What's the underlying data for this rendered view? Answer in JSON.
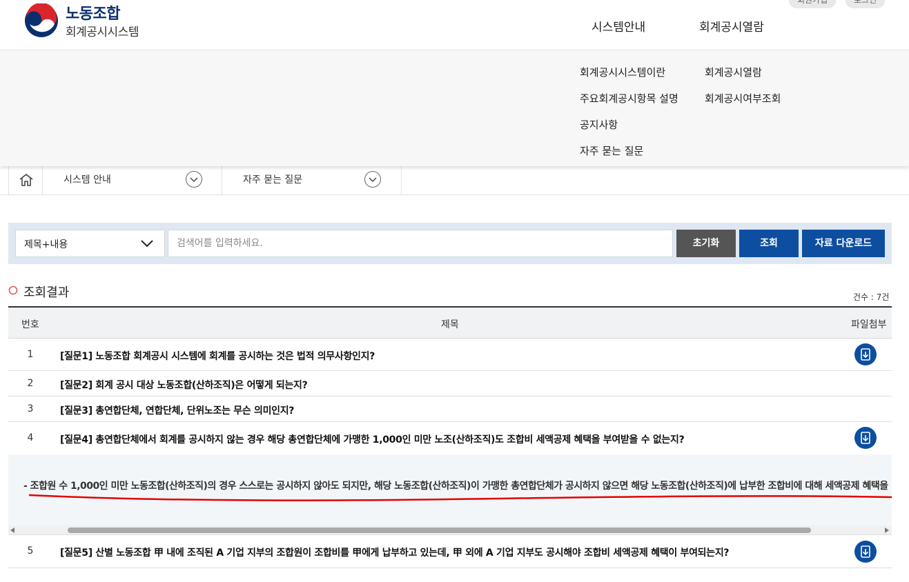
{
  "header": {
    "logo_title": "노동조합",
    "logo_subtitle": "회계공시시스템",
    "util_links": [
      "회원가입",
      "로그인"
    ],
    "nav": [
      "시스템안내",
      "회계공시열람"
    ]
  },
  "mega_menu": {
    "col1": [
      "회계공시시스템이란",
      "주요회계공시항목 설명",
      "공지사항",
      "자주 묻는 질문"
    ],
    "col2": [
      "회계공시열람",
      "회계공시여부조회"
    ]
  },
  "breadcrumb": {
    "level1": "시스템 안내",
    "level2": "자주 묻는 질문"
  },
  "search": {
    "select_value": "제목+내용",
    "placeholder": "검색어를 입력하세요.",
    "reset_label": "초기화",
    "search_label": "조회",
    "download_label": "자료 다운로드"
  },
  "results": {
    "title": "조회결과",
    "count": "건수 : 7건",
    "headers": [
      "번호",
      "제목",
      "파일첨부"
    ],
    "rows": [
      {
        "num": "1",
        "title": "[질문1] 노동조합 회계공시 시스템에 회계를 공시하는 것은 법적 의무사항인지?",
        "attachment": true
      },
      {
        "num": "2",
        "title": "[질문2] 회계 공시 대상 노동조합(산하조직)은 어떻게 되는지?",
        "attachment": false
      },
      {
        "num": "3",
        "title": "[질문3] 총연합단체, 연합단체, 단위노조는 무슨 의미인지?",
        "attachment": false
      },
      {
        "num": "4",
        "title": "[질문4] 총연합단체에서 회계를 공시하지 않는 경우 해당 총연합단체에 가맹한 1,000인 미만 노조(산하조직)도 조합비 세액공제 혜택을 부여받을 수 없는지?",
        "attachment": true
      },
      {
        "num": "5",
        "title": "[질문5] 산별 노동조합 甲 내에 조직된 A 기업 지부의 조합원이 조합비를 甲에게 납부하고 있는데, 甲 외에 A 기업 지부도 공시해야 조합비 세액공제 혜택이 부여되는지?",
        "attachment": true
      }
    ],
    "answer": "- 조합원 수 1,000인 미만 노동조합(산하조직)의 경우 스스로는 공시하지 않아도 되지만, 해당 노동조합(산하조직)이 가맹한 총연합단체가 공시하지 않으면 해당 노동조합(산하조직)에 납부한 조합비에 대해 세액공제 혜택을"
  },
  "colors": {
    "brand_navy": "#0b2f6e",
    "button_blue": "#0d4ea0",
    "button_gray": "#555555",
    "annotation_red": "#e60000"
  }
}
